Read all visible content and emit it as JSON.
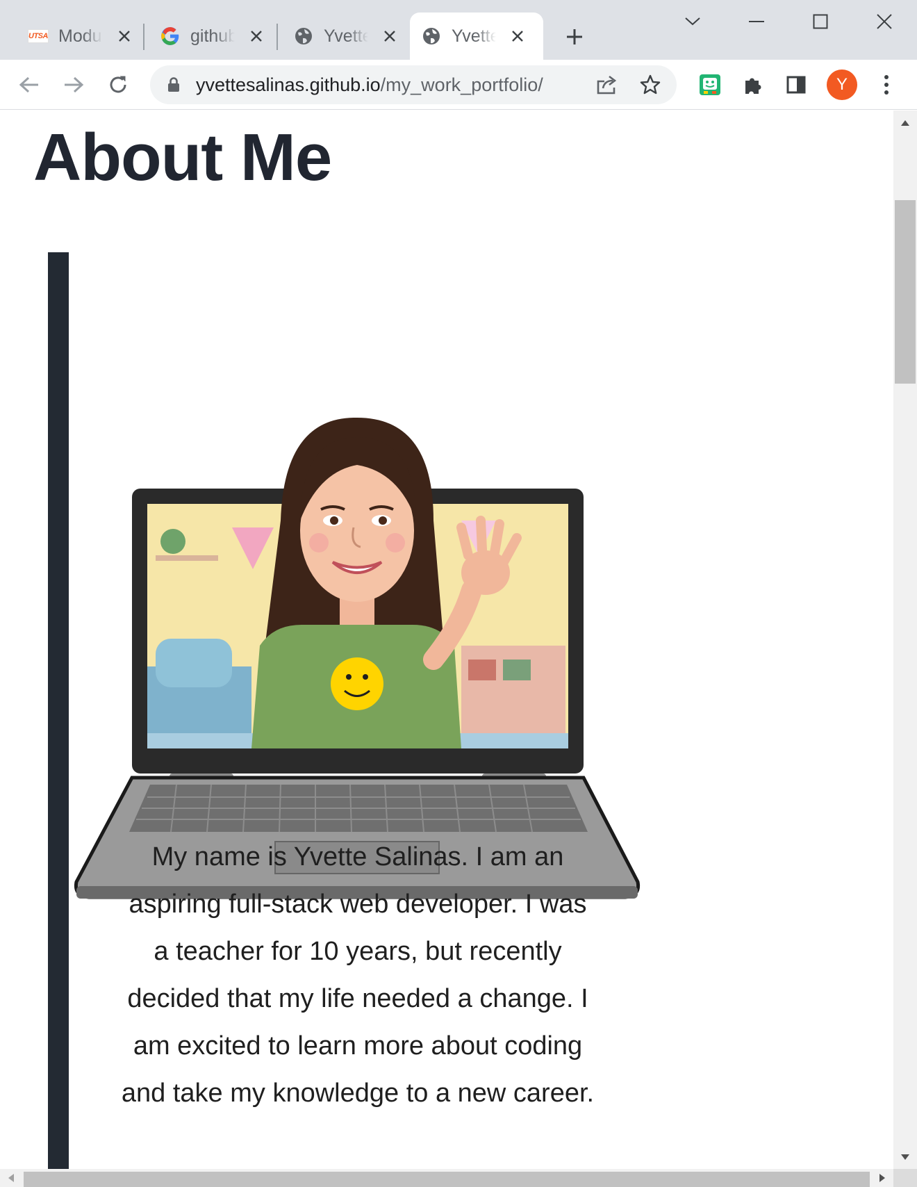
{
  "browser": {
    "tabs": [
      {
        "title": "Module",
        "favicon": "utsa-logo-icon",
        "favicon_text": "UTSA",
        "active": false
      },
      {
        "title": "github",
        "favicon": "google-g-icon",
        "active": false
      },
      {
        "title": "Yvette",
        "favicon": "globe-icon",
        "active": false
      },
      {
        "title": "Yvette",
        "favicon": "globe-icon",
        "active": true
      }
    ],
    "url_host": "yvettesalinas.github.io",
    "url_path": "/my_work_portfolio/",
    "profile_initial": "Y",
    "colors": {
      "tabstrip": "#dee1e6",
      "omnibox": "#f1f3f4",
      "avatar": "#f25a22",
      "extension": "#22b573"
    }
  },
  "page": {
    "title": "About Me",
    "about_text": "My name is Yvette Salinas. I am an aspiring full-stack web developer. I was a teacher for 10 years, but recently decided that my life needed a change. I am excited to learn more about coding and take my knowledge to a new career.",
    "colors": {
      "title": "#212631",
      "accent_bar": "#232a33",
      "text": "#1f1f1f"
    }
  }
}
